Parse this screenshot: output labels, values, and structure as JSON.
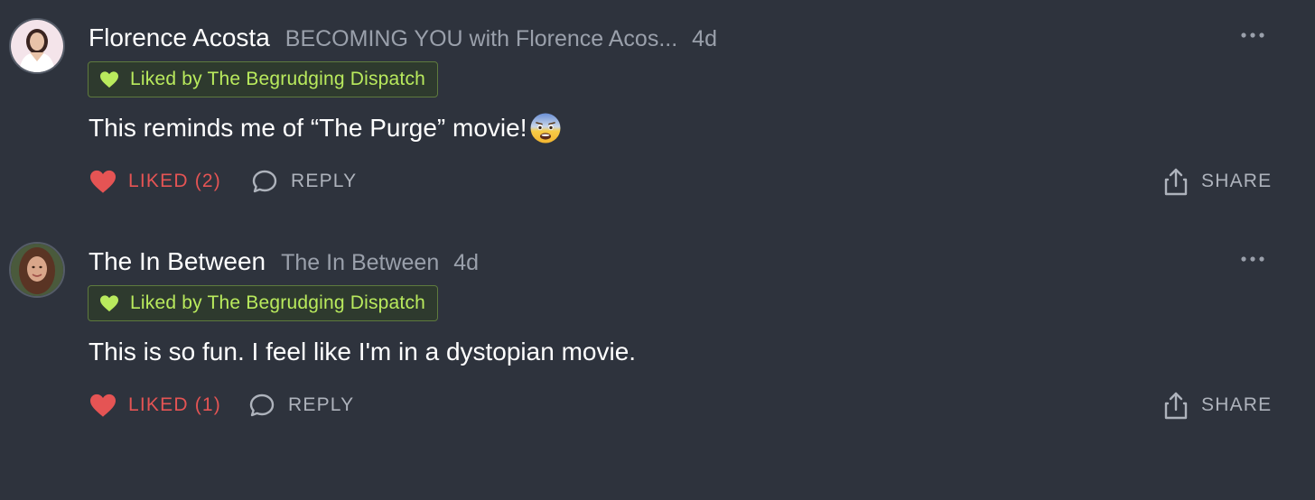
{
  "colors": {
    "background": "#2e333d",
    "liked": "#e55454",
    "badge_text": "#b9ea5d",
    "muted": "#9aa0ab"
  },
  "comments": [
    {
      "author": "Florence Acosta",
      "publication": "BECOMING YOU with Florence Acos...",
      "time": "4d",
      "badge": "Liked by The Begrudging Dispatch",
      "text": "This reminds me of “The Purge” movie!",
      "emoji": "fearful-face-icon",
      "liked_label": "LIKED (2)",
      "reply_label": "REPLY",
      "share_label": "SHARE"
    },
    {
      "author": "The In Between",
      "publication": "The In Between",
      "time": "4d",
      "badge": "Liked by The Begrudging Dispatch",
      "text": "This is so fun. I feel like I'm in a dystopian movie.",
      "liked_label": "LIKED (1)",
      "reply_label": "REPLY",
      "share_label": "SHARE"
    }
  ]
}
